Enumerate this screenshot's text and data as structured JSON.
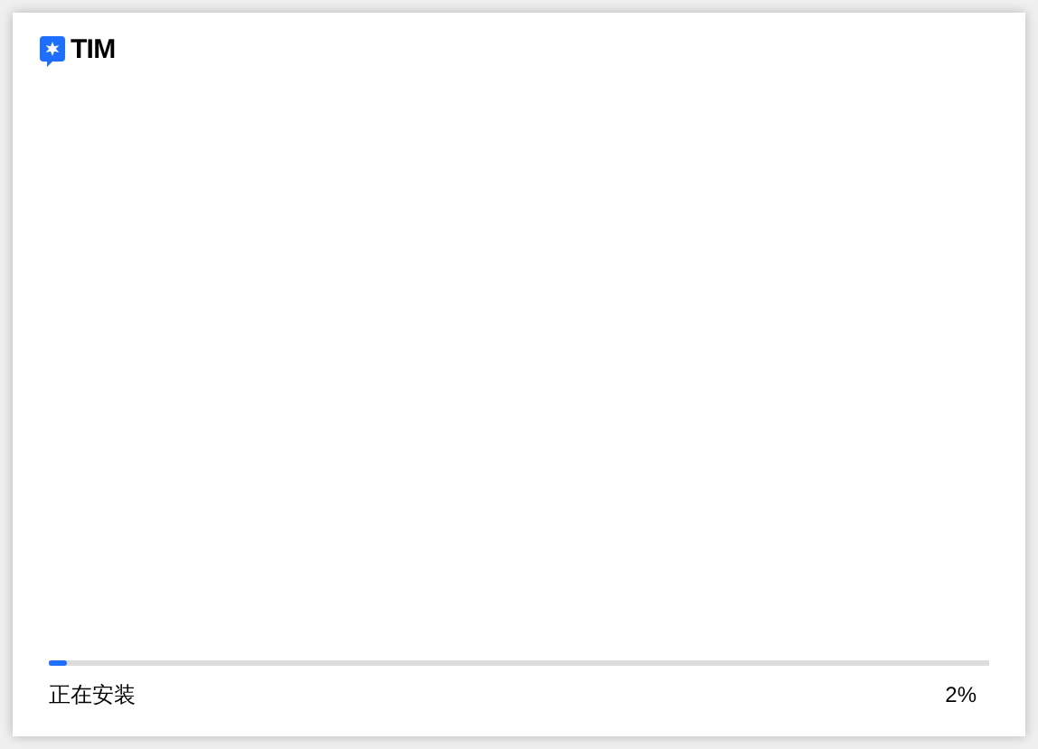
{
  "app": {
    "name": "TIM"
  },
  "progress": {
    "level": 0.02,
    "status": "正在安装",
    "reading": "2%"
  }
}
